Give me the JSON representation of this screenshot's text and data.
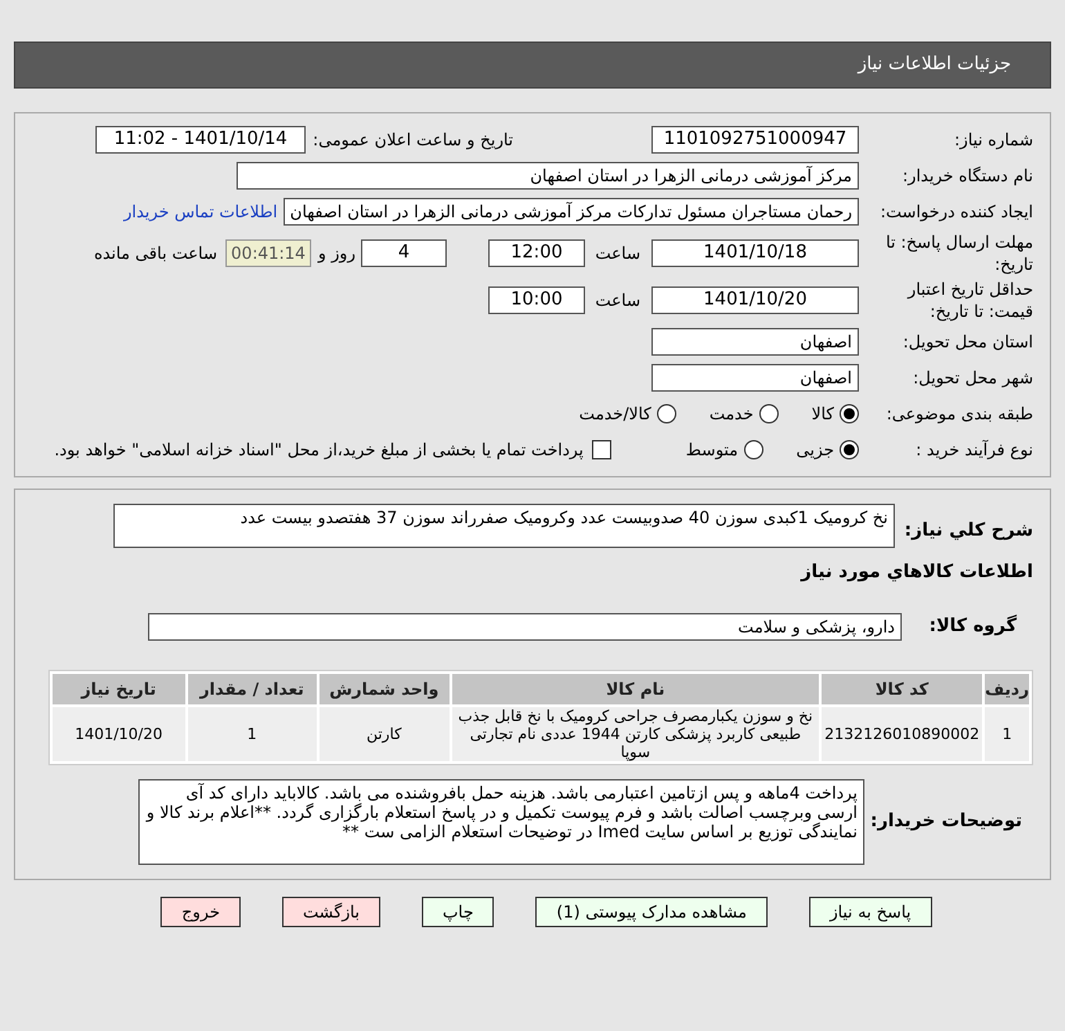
{
  "header": {
    "title": "جزئیات اطلاعات نیاز"
  },
  "need_number": {
    "label": "شماره نیاز:",
    "value": "1101092751000947"
  },
  "announce": {
    "label": "تاریخ و ساعت اعلان عمومی:",
    "value": "1401/10/14 - 11:02"
  },
  "buyer_org": {
    "label": "نام دستگاه خریدار:",
    "value": "مرکز آموزشی درمانی الزهرا در استان اصفهان"
  },
  "requester": {
    "label": "ایجاد کننده درخواست:",
    "value": "رحمان مستاجران مسئول تدارکات مرکز آموزشی درمانی الزهرا در استان اصفهان",
    "link": "اطلاعات تماس خریدار"
  },
  "deadline": {
    "label": "مهلت ارسال پاسخ: تا تاریخ:",
    "date": "1401/10/18",
    "time_label": "ساعت",
    "time": "12:00",
    "days": "4",
    "days_label": "روز و",
    "remaining": "00:41:14",
    "remaining_label": "ساعت باقی مانده"
  },
  "validity": {
    "label": "حداقل تاریخ اعتبار قیمت: تا تاریخ:",
    "date": "1401/10/20",
    "time_label": "ساعت",
    "time": "10:00"
  },
  "province": {
    "label": "استان محل تحویل:",
    "value": "اصفهان"
  },
  "city": {
    "label": "شهر محل تحویل:",
    "value": "اصفهان"
  },
  "category": {
    "label": "طبقه بندی موضوعی:",
    "options": [
      {
        "label": "کالا",
        "selected": true
      },
      {
        "label": "خدمت",
        "selected": false
      },
      {
        "label": "کالا/خدمت",
        "selected": false
      }
    ]
  },
  "process": {
    "label": "نوع فرآیند خرید :",
    "options": [
      {
        "label": "جزیی",
        "selected": true
      },
      {
        "label": "متوسط",
        "selected": false
      }
    ],
    "treasury": {
      "checked": false,
      "label": "پرداخت تمام یا بخشی از مبلغ خرید،از محل \"اسناد خزانه اسلامی\" خواهد بود."
    }
  },
  "summary": {
    "label": "شرح کلي نياز:",
    "value": "نخ کرومیک 1کبدی سوزن 40 صدوبیست عدد وکرومیک صفرراند سوزن 37 هفتصدو بیست عدد"
  },
  "goods_heading": "اطلاعات کالاهاي مورد نياز",
  "goods_group": {
    "label": "گروه کالا:",
    "value": "دارو، پزشکی و سلامت"
  },
  "table": {
    "columns": [
      "ردیف",
      "کد کالا",
      "نام کالا",
      "واحد شمارش",
      "تعداد / مقدار",
      "تاریخ نیاز"
    ],
    "rows": [
      [
        "1",
        "2132126010890002",
        "نخ و سوزن یکبارمصرف جراحی کرومیک با نخ قابل جذب طبیعی کاربرد پزشکی کارتن 1944 عددی نام تجارتی سوپا",
        "کارتن",
        "1",
        "1401/10/20"
      ]
    ]
  },
  "buyer_notes": {
    "label": "توضیحات خریدار:",
    "value": "پرداخت 4ماهه و پس ازتامین اعتبارمی باشد. هزینه حمل بافروشنده می باشد. کالاباید دارای کد آی ارسی وبرچسب اصالت باشد و فرم پیوست تکمیل و در پاسخ استعلام بارگزاری گردد. **اعلام برند کالا و نمایندگی توزیع بر اساس سایت Imed در توضیحات استعلام الزامی ست **"
  },
  "buttons": [
    {
      "label": "پاسخ به نیاز",
      "kind": "normal"
    },
    {
      "label": "مشاهده مدارک پیوستی (1)",
      "kind": "normal"
    },
    {
      "label": "چاپ",
      "kind": "normal"
    },
    {
      "label": "بازگشت",
      "kind": "danger"
    },
    {
      "label": "خروج",
      "kind": "danger"
    }
  ]
}
